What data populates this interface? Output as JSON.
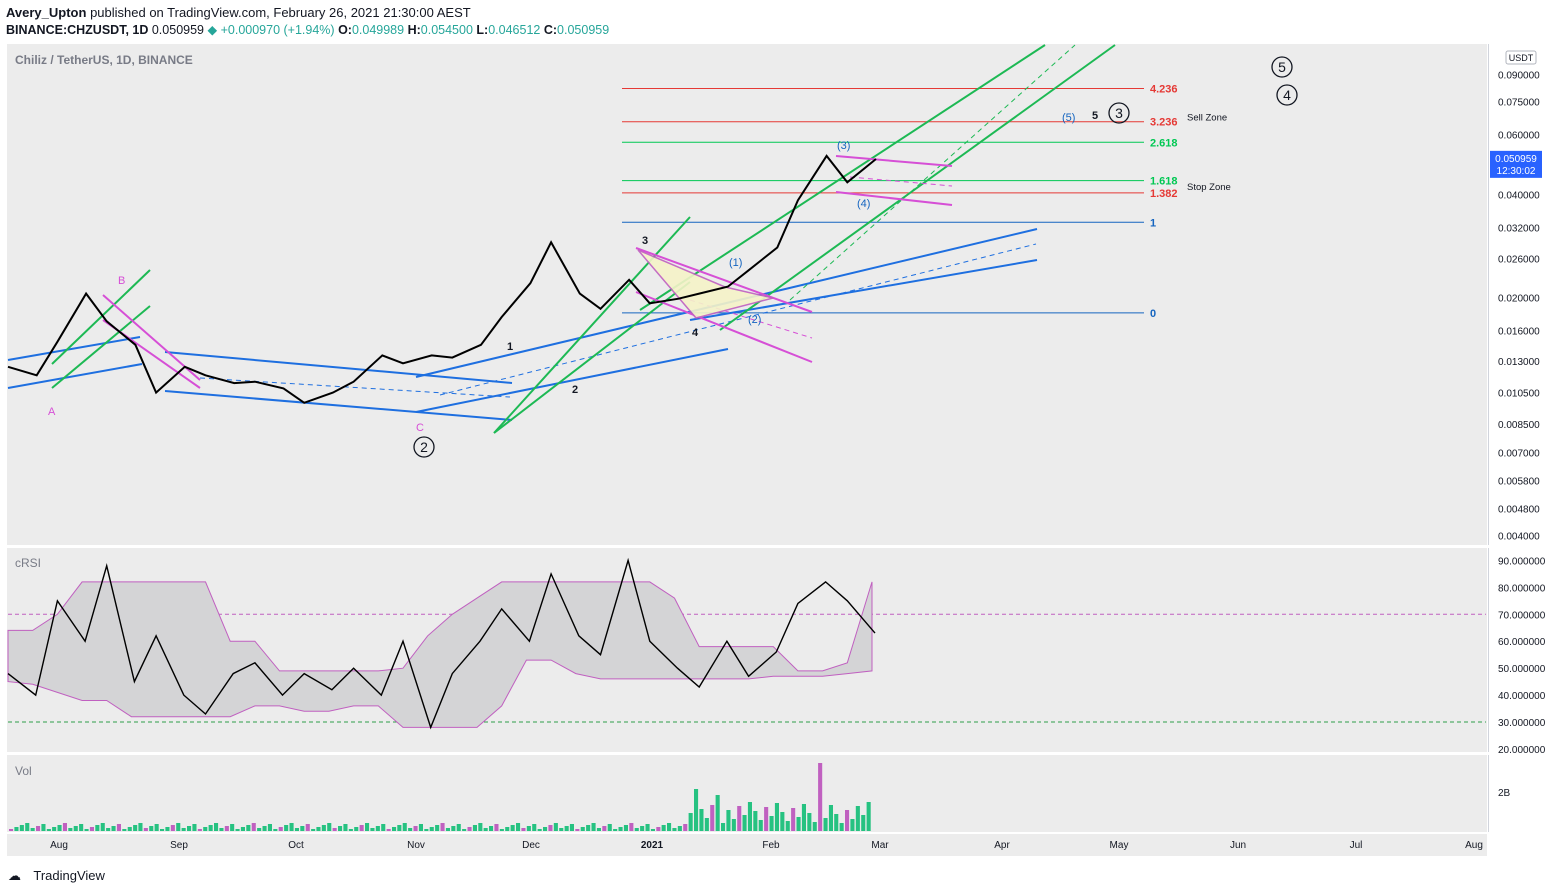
{
  "header": {
    "author": "Avery_Upton",
    "published_text": "published on TradingView.com, February 26, 2021 21:30:00 AEST",
    "symbol": "BINANCE:CHZUSDT, 1D",
    "price": "0.050959",
    "change": "+0.000970 (+1.94%)",
    "ohlc": {
      "O": "0.049989",
      "H": "0.054500",
      "L": "0.046512",
      "C": "0.050959"
    }
  },
  "main_pane": {
    "title": "Chiliz / TetherUS, 1D, BINANCE",
    "currency_badge": "USDT",
    "price_ticks": [
      "0.090000",
      "0.075000",
      "0.060000",
      "0.040000",
      "0.032000",
      "0.026000",
      "0.020000",
      "0.016000",
      "0.013000",
      "0.010500",
      "0.008500",
      "0.007000",
      "0.005800",
      "0.004800",
      "0.004000"
    ],
    "last_price_label": "0.050959",
    "countdown": "12:30:02",
    "fib_levels": [
      {
        "label": "4.236",
        "color": "#e53935"
      },
      {
        "label": "3.236",
        "color": "#e53935"
      },
      {
        "label": "2.618",
        "color": "#00c853"
      },
      {
        "label": "1.618",
        "color": "#00c853"
      },
      {
        "label": "1.382",
        "color": "#e53935"
      },
      {
        "label": "1",
        "color": "#1565c0"
      },
      {
        "label": "0",
        "color": "#1565c0"
      }
    ],
    "zone_labels": {
      "sell": "Sell Zone",
      "stop": "Stop Zone"
    },
    "wave_labels": {
      "A": "A",
      "B": "B",
      "C": "C",
      "w1": "1",
      "w2": "2",
      "w3": "3",
      "w4": "4",
      "w5": "5",
      "sub1": "(1)",
      "sub2": "(2)",
      "sub3": "(3)",
      "sub4": "(4)",
      "sub5": "(5)",
      "big2": "2",
      "big3": "3",
      "big4": "4",
      "big5": "5"
    }
  },
  "crsi_pane": {
    "title": "cRSI",
    "ticks": [
      "90.000000",
      "80.000000",
      "70.000000",
      "60.000000",
      "50.000000",
      "40.000000",
      "30.000000",
      "20.000000"
    ]
  },
  "vol_pane": {
    "title": "Vol",
    "tick": "2B"
  },
  "time_axis": [
    "Aug",
    "Sep",
    "Oct",
    "Nov",
    "Dec",
    "2021",
    "Feb",
    "Mar",
    "Apr",
    "May",
    "Jun",
    "Jul",
    "Aug"
  ],
  "footer": {
    "brand": "TradingView"
  },
  "colors": {
    "up": "#26a69a",
    "price_line": "#000000",
    "blue_channel": "#1e6fe0",
    "green_channel": "#1db954",
    "magenta": "#d64fd6",
    "fib_red": "#e53935",
    "fib_green": "#00c853",
    "fib_blue": "#1565c0"
  },
  "chart_data": {
    "type": "line",
    "title": "Chiliz / TetherUS, 1D, BINANCE",
    "scale": "log",
    "ylim": [
      0.0038,
      0.11
    ],
    "x": [
      "Aug",
      "Sep",
      "Oct",
      "Nov",
      "Dec",
      "2021",
      "Feb",
      "Mar"
    ],
    "series": [
      {
        "values": [
          0.0125,
          0.0118,
          0.0148,
          0.0205,
          0.017,
          0.0145,
          0.0105,
          0.0125,
          0.0118,
          0.0112,
          0.0113,
          0.0108,
          0.0098,
          0.0105,
          0.0113,
          0.0135,
          0.0128,
          0.0135,
          0.0133,
          0.0145,
          0.0175,
          0.022,
          0.029,
          0.0205,
          0.0185,
          0.0225,
          0.0192,
          0.0198,
          0.0205,
          0.0215,
          0.024,
          0.028,
          0.0385,
          0.052,
          0.0435,
          0.0509
        ]
      }
    ],
    "fib_values": [
      {
        "label": "4.236",
        "value": 0.082
      },
      {
        "label": "3.236",
        "value": 0.0655
      },
      {
        "label": "2.618",
        "value": 0.057
      },
      {
        "label": "1.618",
        "value": 0.044
      },
      {
        "label": "1.382",
        "value": 0.0405
      },
      {
        "label": "1",
        "value": 0.0332
      },
      {
        "label": "0",
        "value": 0.018
      }
    ],
    "crsi": {
      "ylim": [
        20,
        92
      ],
      "upper_band": 70,
      "lower_band": 30
    },
    "volume": {
      "label": "Vol"
    }
  }
}
